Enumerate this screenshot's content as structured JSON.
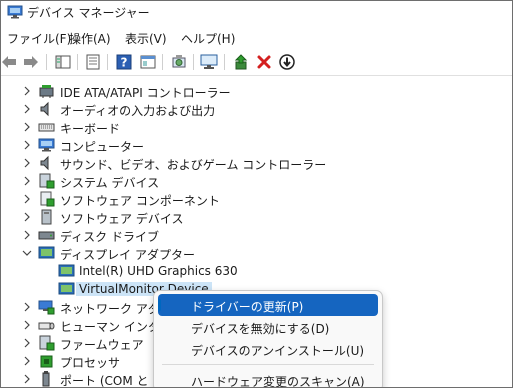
{
  "window": {
    "title": "デバイス マネージャー"
  },
  "menu": [
    "ファイル(F)",
    "操作(A)",
    "表示(V)",
    "ヘルプ(H)"
  ],
  "toolbar": [
    {
      "icon": "back-arrow-icon"
    },
    {
      "icon": "forward-arrow-icon"
    },
    {
      "icon": "show-hide-console-tree-icon"
    },
    {
      "icon": "properties-icon"
    },
    {
      "icon": "help-icon"
    },
    {
      "icon": "view-icon"
    },
    {
      "icon": "scan-hardware-icon"
    },
    {
      "icon": "monitor-icon"
    },
    {
      "icon": "update-driver-icon"
    },
    {
      "icon": "uninstall-device-icon"
    },
    {
      "icon": "disable-device-icon"
    }
  ],
  "tree": [
    {
      "label": "IDE ATA/ATAPI コントローラー",
      "icon": "ide-controller-icon",
      "expanded": false
    },
    {
      "label": "オーディオの入力および出力",
      "icon": "speaker-icon",
      "expanded": false
    },
    {
      "label": "キーボード",
      "icon": "keyboard-icon",
      "expanded": false
    },
    {
      "label": "コンピューター",
      "icon": "computer-icon",
      "expanded": false
    },
    {
      "label": "サウンド、ビデオ、およびゲーム コントローラー",
      "icon": "speaker-icon",
      "expanded": false
    },
    {
      "label": "システム デバイス",
      "icon": "system-device-icon",
      "expanded": false
    },
    {
      "label": "ソフトウェア コンポーネント",
      "icon": "software-component-icon",
      "expanded": false
    },
    {
      "label": "ソフトウェア デバイス",
      "icon": "software-device-icon",
      "expanded": false
    },
    {
      "label": "ディスク ドライブ",
      "icon": "disk-drive-icon",
      "expanded": false
    },
    {
      "label": "ディスプレイ アダプター",
      "icon": "display-adapter-icon",
      "expanded": true
    },
    {
      "label": "Intel(R) UHD Graphics 630",
      "icon": "display-adapter-icon",
      "child": true
    },
    {
      "label": "VirtualMonitor Device",
      "icon": "display-adapter-icon",
      "child": true,
      "selected": true
    },
    {
      "label": "ネットワーク アダプター",
      "icon": "network-icon",
      "expanded": false
    },
    {
      "label": "ヒューマン インターフェ",
      "icon": "hid-icon",
      "expanded": false
    },
    {
      "label": "ファームウェア",
      "icon": "firmware-icon",
      "expanded": false
    },
    {
      "label": "プロセッサ",
      "icon": "processor-icon",
      "expanded": false
    },
    {
      "label": "ポート (COM と LPT",
      "icon": "port-icon",
      "expanded": false
    }
  ],
  "context_menu": [
    {
      "label": "ドライバーの更新(P)",
      "highlighted": true
    },
    {
      "label": "デバイスを無効にする(D)"
    },
    {
      "label": "デバイスのアンインストール(U)"
    },
    {
      "label": "ハードウェア変更のスキャン(A)"
    }
  ],
  "colors": {
    "accent": "#0067c0",
    "selection": "#cce4f7",
    "menu_highlight": "#1565c0"
  }
}
